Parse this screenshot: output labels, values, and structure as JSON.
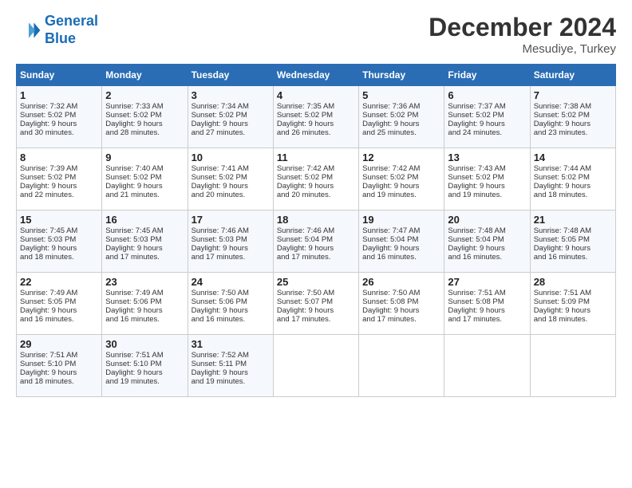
{
  "logo": {
    "line1": "General",
    "line2": "Blue"
  },
  "title": "December 2024",
  "subtitle": "Mesudiye, Turkey",
  "days_header": [
    "Sunday",
    "Monday",
    "Tuesday",
    "Wednesday",
    "Thursday",
    "Friday",
    "Saturday"
  ],
  "weeks": [
    [
      {
        "day": "1",
        "lines": [
          "Sunrise: 7:32 AM",
          "Sunset: 5:02 PM",
          "Daylight: 9 hours",
          "and 30 minutes."
        ]
      },
      {
        "day": "2",
        "lines": [
          "Sunrise: 7:33 AM",
          "Sunset: 5:02 PM",
          "Daylight: 9 hours",
          "and 28 minutes."
        ]
      },
      {
        "day": "3",
        "lines": [
          "Sunrise: 7:34 AM",
          "Sunset: 5:02 PM",
          "Daylight: 9 hours",
          "and 27 minutes."
        ]
      },
      {
        "day": "4",
        "lines": [
          "Sunrise: 7:35 AM",
          "Sunset: 5:02 PM",
          "Daylight: 9 hours",
          "and 26 minutes."
        ]
      },
      {
        "day": "5",
        "lines": [
          "Sunrise: 7:36 AM",
          "Sunset: 5:02 PM",
          "Daylight: 9 hours",
          "and 25 minutes."
        ]
      },
      {
        "day": "6",
        "lines": [
          "Sunrise: 7:37 AM",
          "Sunset: 5:02 PM",
          "Daylight: 9 hours",
          "and 24 minutes."
        ]
      },
      {
        "day": "7",
        "lines": [
          "Sunrise: 7:38 AM",
          "Sunset: 5:02 PM",
          "Daylight: 9 hours",
          "and 23 minutes."
        ]
      }
    ],
    [
      {
        "day": "8",
        "lines": [
          "Sunrise: 7:39 AM",
          "Sunset: 5:02 PM",
          "Daylight: 9 hours",
          "and 22 minutes."
        ]
      },
      {
        "day": "9",
        "lines": [
          "Sunrise: 7:40 AM",
          "Sunset: 5:02 PM",
          "Daylight: 9 hours",
          "and 21 minutes."
        ]
      },
      {
        "day": "10",
        "lines": [
          "Sunrise: 7:41 AM",
          "Sunset: 5:02 PM",
          "Daylight: 9 hours",
          "and 20 minutes."
        ]
      },
      {
        "day": "11",
        "lines": [
          "Sunrise: 7:42 AM",
          "Sunset: 5:02 PM",
          "Daylight: 9 hours",
          "and 20 minutes."
        ]
      },
      {
        "day": "12",
        "lines": [
          "Sunrise: 7:42 AM",
          "Sunset: 5:02 PM",
          "Daylight: 9 hours",
          "and 19 minutes."
        ]
      },
      {
        "day": "13",
        "lines": [
          "Sunrise: 7:43 AM",
          "Sunset: 5:02 PM",
          "Daylight: 9 hours",
          "and 19 minutes."
        ]
      },
      {
        "day": "14",
        "lines": [
          "Sunrise: 7:44 AM",
          "Sunset: 5:02 PM",
          "Daylight: 9 hours",
          "and 18 minutes."
        ]
      }
    ],
    [
      {
        "day": "15",
        "lines": [
          "Sunrise: 7:45 AM",
          "Sunset: 5:03 PM",
          "Daylight: 9 hours",
          "and 18 minutes."
        ]
      },
      {
        "day": "16",
        "lines": [
          "Sunrise: 7:45 AM",
          "Sunset: 5:03 PM",
          "Daylight: 9 hours",
          "and 17 minutes."
        ]
      },
      {
        "day": "17",
        "lines": [
          "Sunrise: 7:46 AM",
          "Sunset: 5:03 PM",
          "Daylight: 9 hours",
          "and 17 minutes."
        ]
      },
      {
        "day": "18",
        "lines": [
          "Sunrise: 7:46 AM",
          "Sunset: 5:04 PM",
          "Daylight: 9 hours",
          "and 17 minutes."
        ]
      },
      {
        "day": "19",
        "lines": [
          "Sunrise: 7:47 AM",
          "Sunset: 5:04 PM",
          "Daylight: 9 hours",
          "and 16 minutes."
        ]
      },
      {
        "day": "20",
        "lines": [
          "Sunrise: 7:48 AM",
          "Sunset: 5:04 PM",
          "Daylight: 9 hours",
          "and 16 minutes."
        ]
      },
      {
        "day": "21",
        "lines": [
          "Sunrise: 7:48 AM",
          "Sunset: 5:05 PM",
          "Daylight: 9 hours",
          "and 16 minutes."
        ]
      }
    ],
    [
      {
        "day": "22",
        "lines": [
          "Sunrise: 7:49 AM",
          "Sunset: 5:05 PM",
          "Daylight: 9 hours",
          "and 16 minutes."
        ]
      },
      {
        "day": "23",
        "lines": [
          "Sunrise: 7:49 AM",
          "Sunset: 5:06 PM",
          "Daylight: 9 hours",
          "and 16 minutes."
        ]
      },
      {
        "day": "24",
        "lines": [
          "Sunrise: 7:50 AM",
          "Sunset: 5:06 PM",
          "Daylight: 9 hours",
          "and 16 minutes."
        ]
      },
      {
        "day": "25",
        "lines": [
          "Sunrise: 7:50 AM",
          "Sunset: 5:07 PM",
          "Daylight: 9 hours",
          "and 17 minutes."
        ]
      },
      {
        "day": "26",
        "lines": [
          "Sunrise: 7:50 AM",
          "Sunset: 5:08 PM",
          "Daylight: 9 hours",
          "and 17 minutes."
        ]
      },
      {
        "day": "27",
        "lines": [
          "Sunrise: 7:51 AM",
          "Sunset: 5:08 PM",
          "Daylight: 9 hours",
          "and 17 minutes."
        ]
      },
      {
        "day": "28",
        "lines": [
          "Sunrise: 7:51 AM",
          "Sunset: 5:09 PM",
          "Daylight: 9 hours",
          "and 18 minutes."
        ]
      }
    ],
    [
      {
        "day": "29",
        "lines": [
          "Sunrise: 7:51 AM",
          "Sunset: 5:10 PM",
          "Daylight: 9 hours",
          "and 18 minutes."
        ]
      },
      {
        "day": "30",
        "lines": [
          "Sunrise: 7:51 AM",
          "Sunset: 5:10 PM",
          "Daylight: 9 hours",
          "and 19 minutes."
        ]
      },
      {
        "day": "31",
        "lines": [
          "Sunrise: 7:52 AM",
          "Sunset: 5:11 PM",
          "Daylight: 9 hours",
          "and 19 minutes."
        ]
      },
      null,
      null,
      null,
      null
    ]
  ]
}
